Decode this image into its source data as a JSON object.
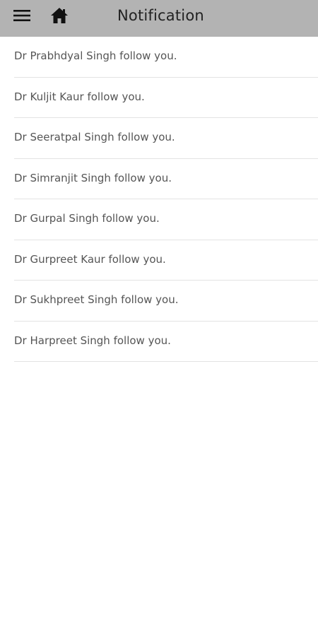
{
  "header": {
    "title": "Notification",
    "menu_icon": "hamburger-menu-icon",
    "home_icon": "home-icon",
    "background_color": "#b3b3b3"
  },
  "notifications": [
    {
      "text": "Dr Prabhdyal Singh follow you."
    },
    {
      "text": "Dr Kuljit Kaur follow you."
    },
    {
      "text": "Dr Seeratpal Singh follow you."
    },
    {
      "text": "Dr Simranjit Singh follow you."
    },
    {
      "text": "Dr Gurpal Singh follow you."
    },
    {
      "text": "Dr Gurpreet Kaur follow you."
    },
    {
      "text": "Dr Sukhpreet Singh follow you."
    },
    {
      "text": "Dr Harpreet Singh follow you."
    }
  ]
}
